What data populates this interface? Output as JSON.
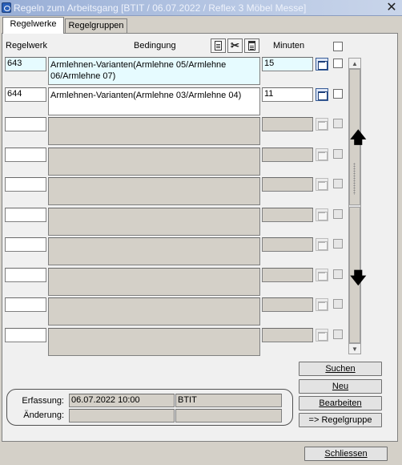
{
  "window": {
    "title": "Regeln zum Arbeitsgang  [BTIT / 06.07.2022 / Reflex 3 Möbel Messe]",
    "close_glyph": "✕"
  },
  "tabs": [
    {
      "label": "Regelwerke",
      "active": true
    },
    {
      "label": "Regelgruppen",
      "active": false
    }
  ],
  "columns": {
    "regelwerk": "Regelwerk",
    "bedingung": "Bedingung",
    "minuten": "Minuten"
  },
  "toolbar_icons": [
    "document-icon",
    "delete-icon",
    "clipboard-icon"
  ],
  "rows": [
    {
      "regelwerk": "643",
      "bedingung": "Armlehnen-Varianten(Armlehne 05/Armlehne 06/Armlehne 07)",
      "minuten": "15",
      "enabled": true,
      "highlighted": true
    },
    {
      "regelwerk": "644",
      "bedingung": "Armlehnen-Varianten(Armlehne 03/Armlehne 04)",
      "minuten": "11",
      "enabled": true,
      "highlighted": false
    },
    {
      "regelwerk": "",
      "bedingung": "",
      "minuten": "",
      "enabled": false
    },
    {
      "regelwerk": "",
      "bedingung": "",
      "minuten": "",
      "enabled": false
    },
    {
      "regelwerk": "",
      "bedingung": "",
      "minuten": "",
      "enabled": false
    },
    {
      "regelwerk": "",
      "bedingung": "",
      "minuten": "",
      "enabled": false
    },
    {
      "regelwerk": "",
      "bedingung": "",
      "minuten": "",
      "enabled": false
    },
    {
      "regelwerk": "",
      "bedingung": "",
      "minuten": "",
      "enabled": false
    },
    {
      "regelwerk": "",
      "bedingung": "",
      "minuten": "",
      "enabled": false
    },
    {
      "regelwerk": "",
      "bedingung": "",
      "minuten": "",
      "enabled": false
    }
  ],
  "buttons": {
    "suchen": "Suchen",
    "neu": "Neu",
    "bearbeiten": "Bearbeiten",
    "regelgruppe": "=> Regelgruppe",
    "schliessen": "Schliessen"
  },
  "footer": {
    "erfassung_label": "Erfassung:",
    "erfassung_date": "06.07.2022 10:00",
    "erfassung_user": "BTIT",
    "aenderung_label": "Änderung:",
    "aenderung_date": "",
    "aenderung_user": ""
  },
  "colors": {
    "highlight_field": "#e6fbff",
    "titlebar": "#98aed6"
  }
}
